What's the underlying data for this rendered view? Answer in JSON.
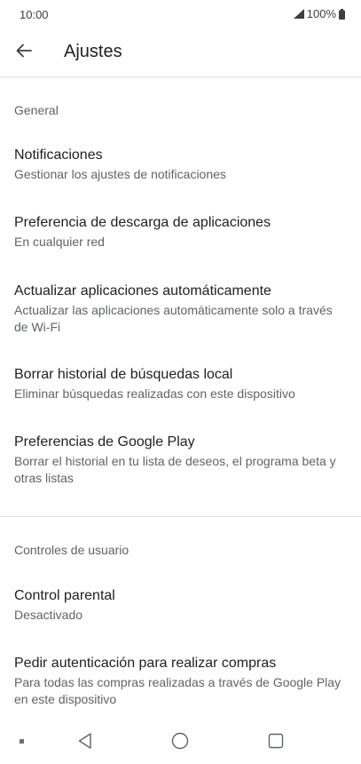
{
  "status_bar": {
    "time": "10:00",
    "battery": "100%"
  },
  "app_bar": {
    "back_icon": "arrow-left-icon",
    "title": "Ajustes"
  },
  "sections": {
    "general": {
      "header": "General",
      "items": [
        {
          "title": "Notificaciones",
          "subtitle": "Gestionar los ajustes de notificaciones"
        },
        {
          "title": "Preferencia de descarga de aplicaciones",
          "subtitle": "En cualquier red"
        },
        {
          "title": "Actualizar aplicaciones automáticamente",
          "subtitle": "Actualizar las aplicaciones automáticamente solo a través de Wi-Fi"
        },
        {
          "title": "Borrar historial de búsquedas local",
          "subtitle": "Eliminar búsquedas realizadas con este dispositivo"
        },
        {
          "title": "Preferencias de Google Play",
          "subtitle": "Borrar el historial en tu lista de deseos, el programa beta y otras listas"
        }
      ]
    },
    "user_controls": {
      "header": "Controles de usuario",
      "items": [
        {
          "title": "Control parental",
          "subtitle": "Desactivado"
        },
        {
          "title": "Pedir autenticación para realizar compras",
          "subtitle": "Para todas las compras realizadas a través de Google Play en este dispositivo"
        }
      ]
    }
  },
  "nav_bar": {
    "back_icon": "triangle-back-icon",
    "home_icon": "circle-home-icon",
    "recents_icon": "square-recents-icon"
  },
  "colors": {
    "primary_text": "#202124",
    "secondary_text": "#5f6368",
    "divider": "#e3e3e3",
    "background": "#ffffff"
  }
}
